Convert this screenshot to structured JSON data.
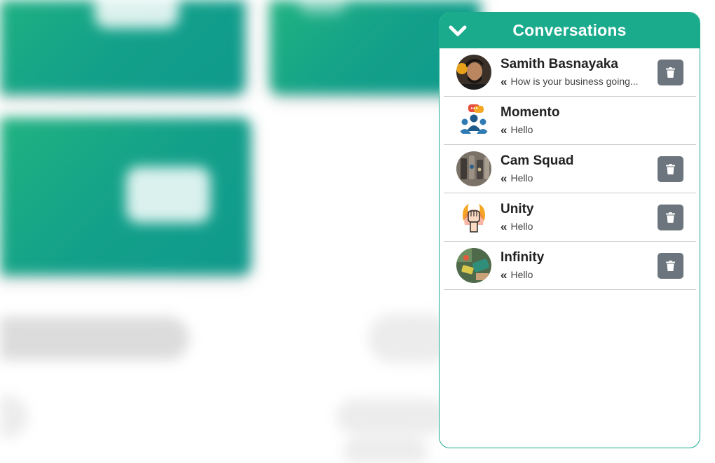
{
  "panel": {
    "title": "Conversations",
    "collapse_icon": "chevron-down-icon",
    "accent_color": "#1aaa8c"
  },
  "conversations": [
    {
      "name": "Samith Basnayaka",
      "last_message": "How is your business going...",
      "reply_icon": "double-left-quote-icon",
      "avatar": "person-photo",
      "deletable": true
    },
    {
      "name": "Momento",
      "last_message": "Hello",
      "reply_icon": "double-left-quote-icon",
      "avatar": "group-chat-icon",
      "deletable": false
    },
    {
      "name": "Cam Squad",
      "last_message": "Hello",
      "reply_icon": "double-left-quote-icon",
      "avatar": "camera-gear-photo",
      "deletable": true
    },
    {
      "name": "Unity",
      "last_message": "Hello",
      "reply_icon": "double-left-quote-icon",
      "avatar": "raised-fist-icon",
      "deletable": true
    },
    {
      "name": "Infinity",
      "last_message": "Hello",
      "reply_icon": "double-left-quote-icon",
      "avatar": "colorful-photo",
      "deletable": true
    }
  ],
  "delete_icon": "trash-icon",
  "delete_button_color": "#6c757d"
}
